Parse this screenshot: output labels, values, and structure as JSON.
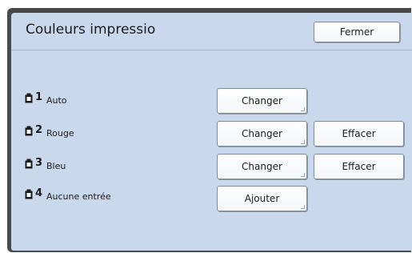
{
  "window": {
    "title": "Couleurs impressio",
    "close_label": "Fermer"
  },
  "rows": [
    {
      "number": "1",
      "label": "Auto",
      "icon": "ink-cartridge-icon",
      "primary_label": "Changer",
      "secondary_label": ""
    },
    {
      "number": "2",
      "label": "Rouge",
      "icon": "ink-cartridge-icon",
      "primary_label": "Changer",
      "secondary_label": "Effacer"
    },
    {
      "number": "3",
      "label": "Bleu",
      "icon": "ink-cartridge-icon",
      "primary_label": "Changer",
      "secondary_label": "Effacer"
    },
    {
      "number": "4",
      "label": "Aucune entrée",
      "icon": "ink-cartridge-icon",
      "primary_label": "Ajouter",
      "secondary_label": ""
    }
  ]
}
